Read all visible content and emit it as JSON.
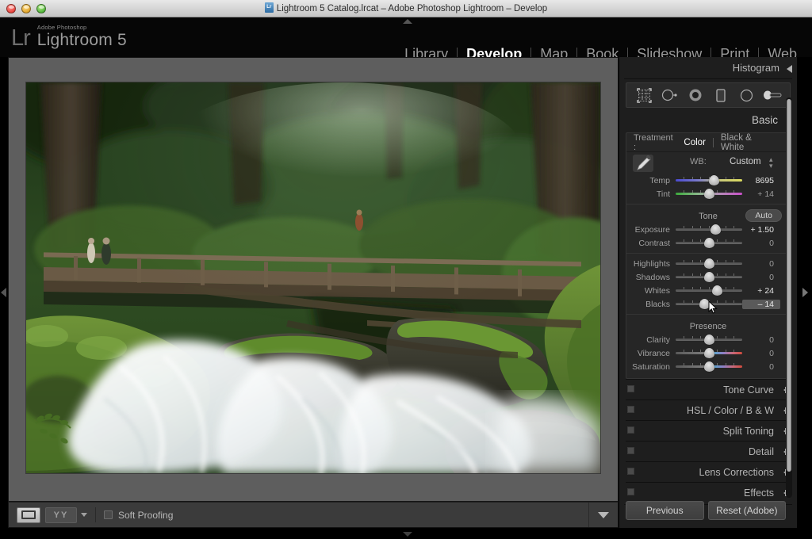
{
  "window": {
    "title": "Lightroom 5 Catalog.lrcat – Adobe Photoshop Lightroom – Develop",
    "doc_icon": "lightroom-document-icon",
    "traffic_lights": [
      "close-button",
      "minimize-button",
      "zoom-button"
    ]
  },
  "identity": {
    "mark": "Lr",
    "superline": "Adobe Photoshop",
    "product": "Lightroom 5"
  },
  "modules": {
    "items": [
      {
        "label": "Library",
        "active": false
      },
      {
        "label": "Develop",
        "active": true
      },
      {
        "label": "Map",
        "active": false
      },
      {
        "label": "Book",
        "active": false
      },
      {
        "label": "Slideshow",
        "active": false
      },
      {
        "label": "Print",
        "active": false
      },
      {
        "label": "Web",
        "active": false
      }
    ]
  },
  "toolbar": {
    "loupe_view": "loupe-view",
    "before_after": "YY",
    "before_after_caret": "caret-down-icon",
    "soft_proofing_label": "Soft Proofing",
    "soft_proofing_checked": false,
    "right_caret": "caret-down-icon"
  },
  "right_panel": {
    "histogram": {
      "title": "Histogram",
      "collapse_icon": "triangle-left-icon"
    },
    "tools": [
      {
        "name": "crop-overlay-tool"
      },
      {
        "name": "spot-removal-tool"
      },
      {
        "name": "red-eye-correction-tool"
      },
      {
        "name": "graduated-filter-tool"
      },
      {
        "name": "radial-filter-tool"
      },
      {
        "name": "adjustment-brush-tool"
      }
    ],
    "basic": {
      "title": "Basic",
      "switch_icon": "panel-switch-icon",
      "treatment": {
        "label": "Treatment :",
        "options": [
          {
            "label": "Color",
            "active": true
          },
          {
            "label": "Black & White",
            "active": false
          }
        ]
      },
      "white_balance": {
        "eyedropper": "white-balance-selector-icon",
        "label": "WB:",
        "value": "Custom",
        "stepper": "stepper-icon",
        "sliders": [
          {
            "name": "Temp",
            "value": "8695",
            "pos": 58,
            "gradient": "linear-gradient(90deg,#4a4ad0,#7a7acb,#c8c87a,#d9d95e)"
          },
          {
            "name": "Tint",
            "value": "+ 14",
            "pos": 50,
            "gradient": "linear-gradient(90deg,#3ba93b,#8ab88a,#b58ab8,#c94fc9)"
          }
        ]
      },
      "tone": {
        "title": "Tone",
        "auto_label": "Auto",
        "sliders": [
          {
            "name": "Exposure",
            "value": "+ 1.50",
            "pos": 60,
            "highlight": true
          },
          {
            "name": "Contrast",
            "value": "0",
            "pos": 50,
            "highlight": false
          },
          {
            "name": "Highlights",
            "value": "0",
            "pos": 50,
            "highlight": false
          },
          {
            "name": "Shadows",
            "value": "0",
            "pos": 50,
            "highlight": false
          },
          {
            "name": "Whites",
            "value": "+ 24",
            "pos": 62,
            "highlight": true
          },
          {
            "name": "Blacks",
            "value": "– 14",
            "pos": 44,
            "highlight": false,
            "active": true
          }
        ]
      },
      "presence": {
        "title": "Presence",
        "sliders": [
          {
            "name": "Clarity",
            "value": "0",
            "pos": 50,
            "gradient": ""
          },
          {
            "name": "Vibrance",
            "value": "0",
            "pos": 50,
            "gradient": "linear-gradient(90deg,#5a5a5a,#7d7d7d 45%,#59a2c9 58%,#8f7ec4 72%,#c96a7a 86%,#cf4a3c)"
          },
          {
            "name": "Saturation",
            "value": "0",
            "pos": 50,
            "gradient": "linear-gradient(90deg,#5a5a5a,#7d7d7d 45%,#59a2c9 58%,#8f7ec4 72%,#c96a7a 86%,#cf4a3c)"
          }
        ]
      }
    },
    "sections": [
      {
        "label": "Tone Curve"
      },
      {
        "label": "HSL / Color / B & W"
      },
      {
        "label": "Split Toning"
      },
      {
        "label": "Detail"
      },
      {
        "label": "Lens Corrections"
      },
      {
        "label": "Effects"
      }
    ],
    "buttons": [
      {
        "label": "Previous"
      },
      {
        "label": "Reset (Adobe)"
      }
    ],
    "scrollbar": "right-panel-scrollbar"
  },
  "photo": {
    "alt": "Long-exposure photograph of a forest waterfall with mossy rocks, a wooden footbridge and two hikers in an old-growth rainforest"
  },
  "collapse_arrows": {
    "left": "left-panel-collapse-arrow",
    "right": "right-panel-collapse-arrow",
    "top": "top-panel-collapse-arrow",
    "bottom": "filmstrip-collapse-arrow"
  },
  "cursor": {
    "name": "mouse-pointer"
  },
  "colors": {
    "panel_bg": "#1e1e1e",
    "canvas_bg": "#5e5e5e",
    "accent_text": "#ffffff",
    "muted_text": "#9d9d9d"
  }
}
